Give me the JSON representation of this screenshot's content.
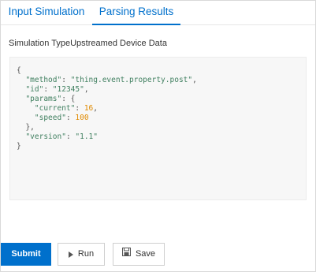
{
  "tabs": [
    {
      "label": "Input Simulation"
    },
    {
      "label": "Parsing Results"
    }
  ],
  "simulation": {
    "label": "Simulation Type",
    "value": "Upstreamed Device Data"
  },
  "code": {
    "l1": "{",
    "method_key": "\"method\"",
    "method_val": "\"thing.event.property.post\"",
    "id_key": "\"id\"",
    "id_val": "\"12345\"",
    "params_key": "\"params\"",
    "current_key": "\"current\"",
    "current_val": "16",
    "speed_key": "\"speed\"",
    "speed_val": "100",
    "close_params": "},",
    "version_key": "\"version\"",
    "version_val": "\"1.1\"",
    "l_end": "}"
  },
  "actions": {
    "submit": "Submit",
    "run": "Run",
    "save": "Save"
  },
  "icons": {
    "run": "play-icon",
    "save": "save-icon"
  },
  "colors": {
    "accent": "#0070cc",
    "code_bg": "#f7f7f7",
    "string": "#3f7f5f",
    "number": "#e08a00"
  }
}
